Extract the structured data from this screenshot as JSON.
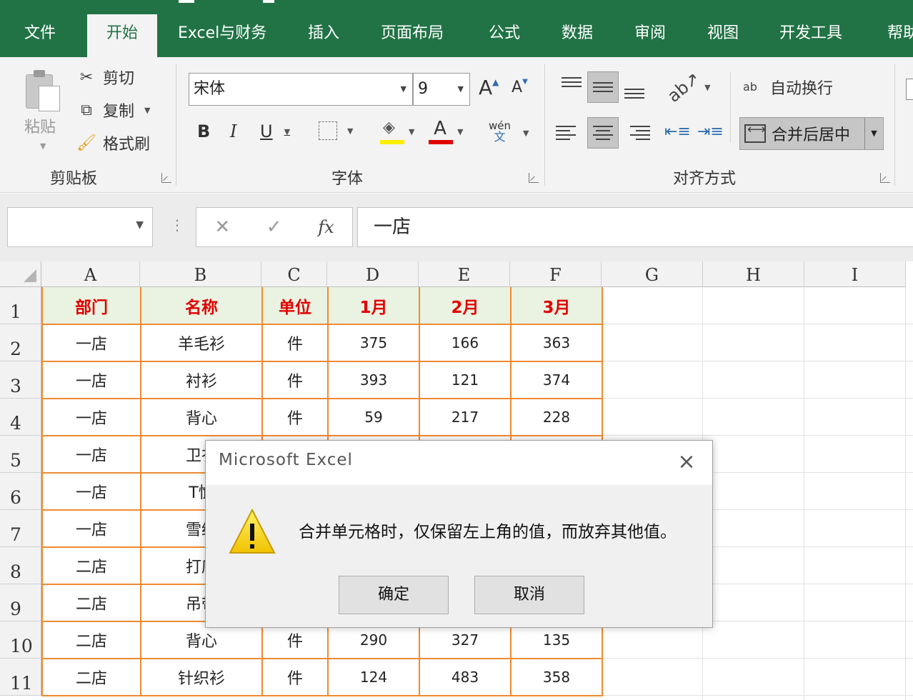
{
  "ribbon": {
    "tabs": [
      "文件",
      "开始",
      "Excel与财务",
      "插入",
      "页面布局",
      "公式",
      "数据",
      "审阅",
      "视图",
      "开发工具",
      "帮助"
    ],
    "active_tab": "开始",
    "clipboard": {
      "paste_label": "粘贴",
      "cut_label": "剪切",
      "copy_label": "复制",
      "format_painter_label": "格式刷",
      "group_label": "剪贴板"
    },
    "font": {
      "font_name": "宋体",
      "font_size": "9",
      "grow_label": "A",
      "shrink_label": "A",
      "bold_label": "B",
      "italic_label": "I",
      "underline_label": "U",
      "font_color_label": "A",
      "phonetic_label": "wén",
      "phonetic_sub": "文",
      "highlight_color": "#ffee00",
      "font_color": "#e00000",
      "group_label": "字体"
    },
    "alignment": {
      "wrap_text_label": "自动换行",
      "wrap_icon_label": "ab",
      "merge_label": "合并后居中",
      "group_label": "对齐方式"
    }
  },
  "formula_bar": {
    "name_box": "",
    "cancel_icon": "✕",
    "enter_icon": "✓",
    "fx_label": "fx",
    "formula": "一店"
  },
  "sheet": {
    "columns": [
      "A",
      "B",
      "C",
      "D",
      "E",
      "F",
      "G",
      "H",
      "I"
    ],
    "rows": [
      "1",
      "2",
      "3",
      "4",
      "5",
      "6",
      "7",
      "8",
      "9",
      "10",
      "11"
    ],
    "header": [
      "部门",
      "名称",
      "单位",
      "1月",
      "2月",
      "3月"
    ],
    "data": [
      [
        "一店",
        "羊毛衫",
        "件",
        "375",
        "166",
        "363"
      ],
      [
        "一店",
        "衬衫",
        "件",
        "393",
        "121",
        "374"
      ],
      [
        "一店",
        "背心",
        "件",
        "59",
        "217",
        "228"
      ],
      [
        "一店",
        "卫衣",
        "",
        "",
        "",
        ""
      ],
      [
        "一店",
        "T恤",
        "",
        "",
        "",
        ""
      ],
      [
        "一店",
        "雪纺",
        "",
        "",
        "",
        ""
      ],
      [
        "二店",
        "打底",
        "",
        "",
        "",
        ""
      ],
      [
        "二店",
        "吊带",
        "",
        "",
        "",
        ""
      ],
      [
        "二店",
        "背心",
        "件",
        "290",
        "327",
        "135"
      ],
      [
        "二店",
        "针织衫",
        "件",
        "124",
        "483",
        "358"
      ]
    ],
    "border_color": "#f08a30",
    "header_text_color": "#e00000",
    "header_fill": "#eaf3e2"
  },
  "dialog": {
    "title": "Microsoft Excel",
    "message": "合并单元格时，仅保留左上角的值，而放弃其他值。",
    "ok_label": "确定",
    "cancel_label": "取消",
    "close_icon": "×"
  },
  "colors": {
    "excel_green": "#217346",
    "ribbon_bg": "#f3f3f3"
  }
}
